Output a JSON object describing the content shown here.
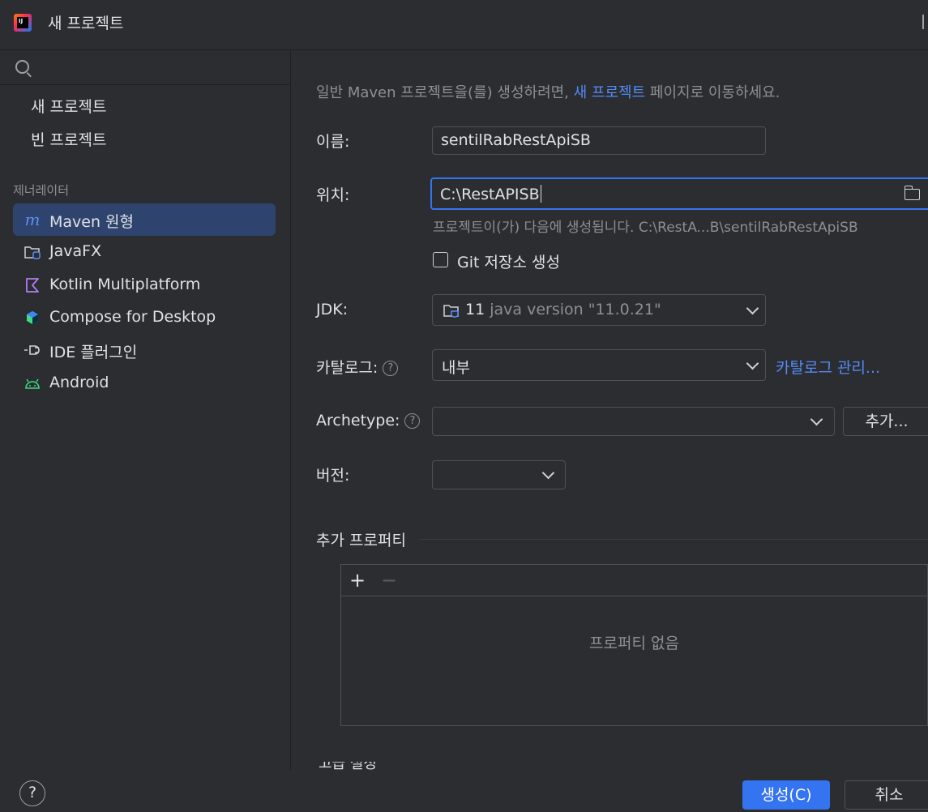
{
  "window": {
    "title": "새 프로젝트",
    "app_icon_text": "IJ"
  },
  "sidebar": {
    "items": [
      {
        "label": "새 프로젝트"
      },
      {
        "label": "빈 프로젝트"
      }
    ],
    "generators_title": "제너레이터",
    "generators": [
      {
        "label": "Maven 원형",
        "icon": "maven-icon",
        "selected": true
      },
      {
        "label": "JavaFX",
        "icon": "javafx-icon"
      },
      {
        "label": "Kotlin Multiplatform",
        "icon": "kotlin-icon"
      },
      {
        "label": "Compose for Desktop",
        "icon": "compose-icon"
      },
      {
        "label": "IDE 플러그인",
        "icon": "plugin-icon"
      },
      {
        "label": "Android",
        "icon": "android-icon"
      }
    ]
  },
  "form": {
    "info_prefix": "일반 Maven 프로젝트을(를) 생성하려면,",
    "info_link": "새 프로젝트",
    "info_suffix": "페이지로 이동하세요.",
    "name_label": "이름:",
    "name_value": "sentilRabRestApiSB",
    "location_label": "위치:",
    "location_value": "C:\\RestAPISB",
    "location_hint": "프로젝트이(가) 다음에 생성됩니다. C:\\RestA...B\\sentilRabRestApiSB",
    "git_label": "Git 저장소 생성",
    "git_checked": false,
    "jdk_label": "JDK:",
    "jdk_version": "11",
    "jdk_desc": "java version \"11.0.21\"",
    "catalog_label": "카탈로그:",
    "catalog_value": "내부",
    "catalog_manage": "카탈로그 관리...",
    "archetype_label": "Archetype:",
    "archetype_value": "",
    "archetype_add": "추가...",
    "version_label": "버전:",
    "version_value": ""
  },
  "properties": {
    "title": "추가 프로퍼티",
    "add_symbol": "+",
    "remove_symbol": "−",
    "empty": "프로퍼티 없음"
  },
  "partial_section": "고급 설정",
  "footer": {
    "help": "?",
    "create": "생성(C)",
    "cancel": "취소"
  },
  "colors": {
    "accent": "#3574f0",
    "link": "#548af7",
    "selection": "#2e436e",
    "background": "#2b2d30"
  }
}
